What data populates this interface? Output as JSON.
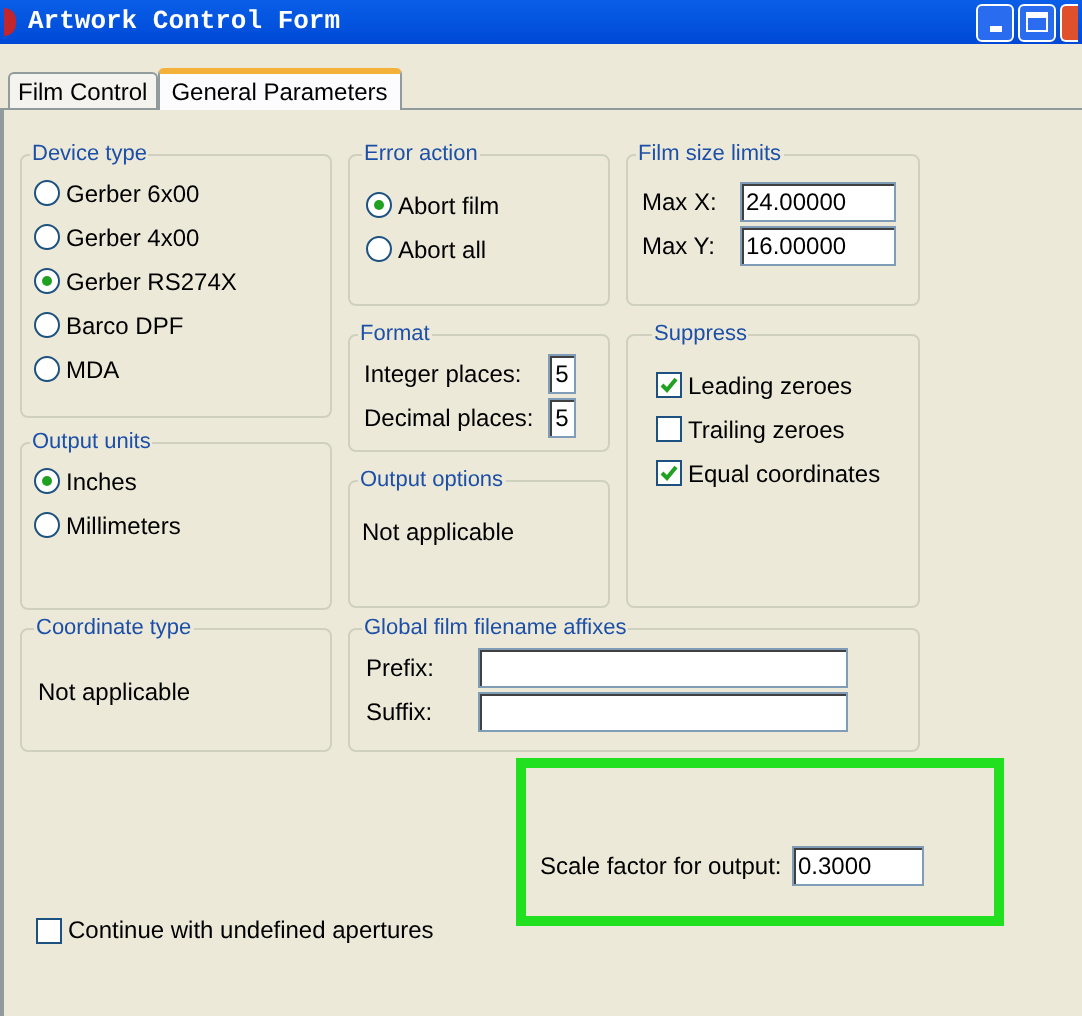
{
  "window": {
    "title": "Artwork Control Form"
  },
  "tabs": [
    {
      "label": "Film Control",
      "selected": false
    },
    {
      "label": "General Parameters",
      "selected": true
    }
  ],
  "device_type": {
    "title": "Device type",
    "options": [
      {
        "label": "Gerber 6x00",
        "selected": false
      },
      {
        "label": "Gerber 4x00",
        "selected": false
      },
      {
        "label": "Gerber RS274X",
        "selected": true
      },
      {
        "label": "Barco DPF",
        "selected": false
      },
      {
        "label": "MDA",
        "selected": false
      }
    ]
  },
  "output_units": {
    "title": "Output units",
    "options": [
      {
        "label": "Inches",
        "selected": true
      },
      {
        "label": "Millimeters",
        "selected": false
      }
    ]
  },
  "coordinate_type": {
    "title": "Coordinate type",
    "text": "Not applicable"
  },
  "error_action": {
    "title": "Error action",
    "options": [
      {
        "label": "Abort film",
        "selected": true
      },
      {
        "label": "Abort all",
        "selected": false
      }
    ]
  },
  "format": {
    "title": "Format",
    "fields": [
      {
        "label": "Integer places:",
        "value": "5"
      },
      {
        "label": "Decimal places:",
        "value": "5"
      }
    ]
  },
  "output_options": {
    "title": "Output options",
    "text": "Not applicable"
  },
  "film_size_limits": {
    "title": "Film size limits",
    "fields": [
      {
        "label": "Max X:",
        "value": "24.00000"
      },
      {
        "label": "Max Y:",
        "value": "16.00000"
      }
    ]
  },
  "suppress": {
    "title": "Suppress",
    "options": [
      {
        "label": "Leading zeroes",
        "checked": true
      },
      {
        "label": "Trailing zeroes",
        "checked": false
      },
      {
        "label": "Equal coordinates",
        "checked": true
      }
    ]
  },
  "filename_affixes": {
    "title": "Global film filename affixes",
    "fields": [
      {
        "label": "Prefix:"
      },
      {
        "label": "Suffix:"
      }
    ]
  },
  "scale_factor": {
    "label": "Scale factor for output:",
    "value": "0.3000"
  },
  "continue_undefined": {
    "label": "Continue with undefined apertures",
    "checked": false
  }
}
